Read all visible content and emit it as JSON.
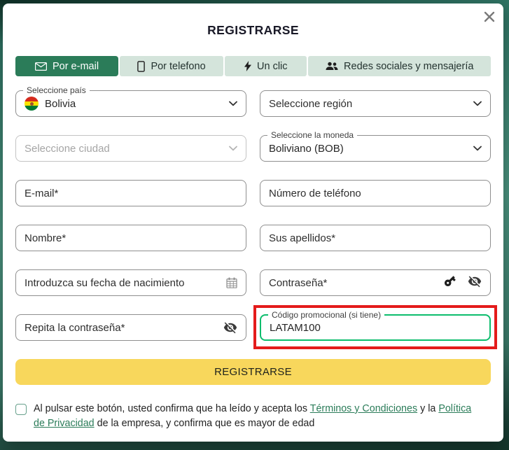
{
  "modal": {
    "title": "REGISTRARSE"
  },
  "tabs": [
    {
      "label": "Por e-mail",
      "icon": "envelope-icon",
      "active": true
    },
    {
      "label": "Por telefono",
      "icon": "smartphone-icon",
      "active": false
    },
    {
      "label": "Un clic",
      "icon": "bolt-icon",
      "active": false
    },
    {
      "label": "Redes sociales y mensajería",
      "icon": "people-icon",
      "active": false
    }
  ],
  "fields": {
    "country": {
      "label": "Seleccione país",
      "value": "Bolivia",
      "flag": "bolivia-flag"
    },
    "region": {
      "placeholder": "Seleccione región"
    },
    "city": {
      "placeholder": "Seleccione ciudad",
      "disabled": true
    },
    "currency": {
      "label": "Seleccione la moneda",
      "value": "Boliviano (BOB)"
    },
    "email": {
      "placeholder": "E-mail*"
    },
    "phone": {
      "placeholder": "Número de teléfono"
    },
    "first_name": {
      "placeholder": "Nombre*"
    },
    "last_name": {
      "placeholder": "Sus apellidos*"
    },
    "birthdate": {
      "placeholder": "Introduzca su fecha de nacimiento"
    },
    "password": {
      "placeholder": "Contraseña*"
    },
    "repeat_password": {
      "placeholder": "Repita la contraseña*"
    },
    "promo": {
      "label": "Código promocional (si tiene)",
      "value": "LATAM100"
    }
  },
  "submit": {
    "label": "REGISTRARSE"
  },
  "terms": {
    "text_before": "Al pulsar este botón, usted confirma que ha leído y acepta los ",
    "link_terms": "Términos y Condiciones",
    "text_middle": " y la ",
    "link_privacy": "Política de Privacidad",
    "text_after": " de la empresa, y confirma que es mayor de edad"
  },
  "colors": {
    "accent_green": "#2b7c59",
    "tab_inactive": "#d4e4db",
    "button_yellow": "#f8d75c",
    "promo_border_green": "#0cbd6d",
    "annotation_red": "#e41b1b",
    "field_border": "#8f8f8f"
  }
}
